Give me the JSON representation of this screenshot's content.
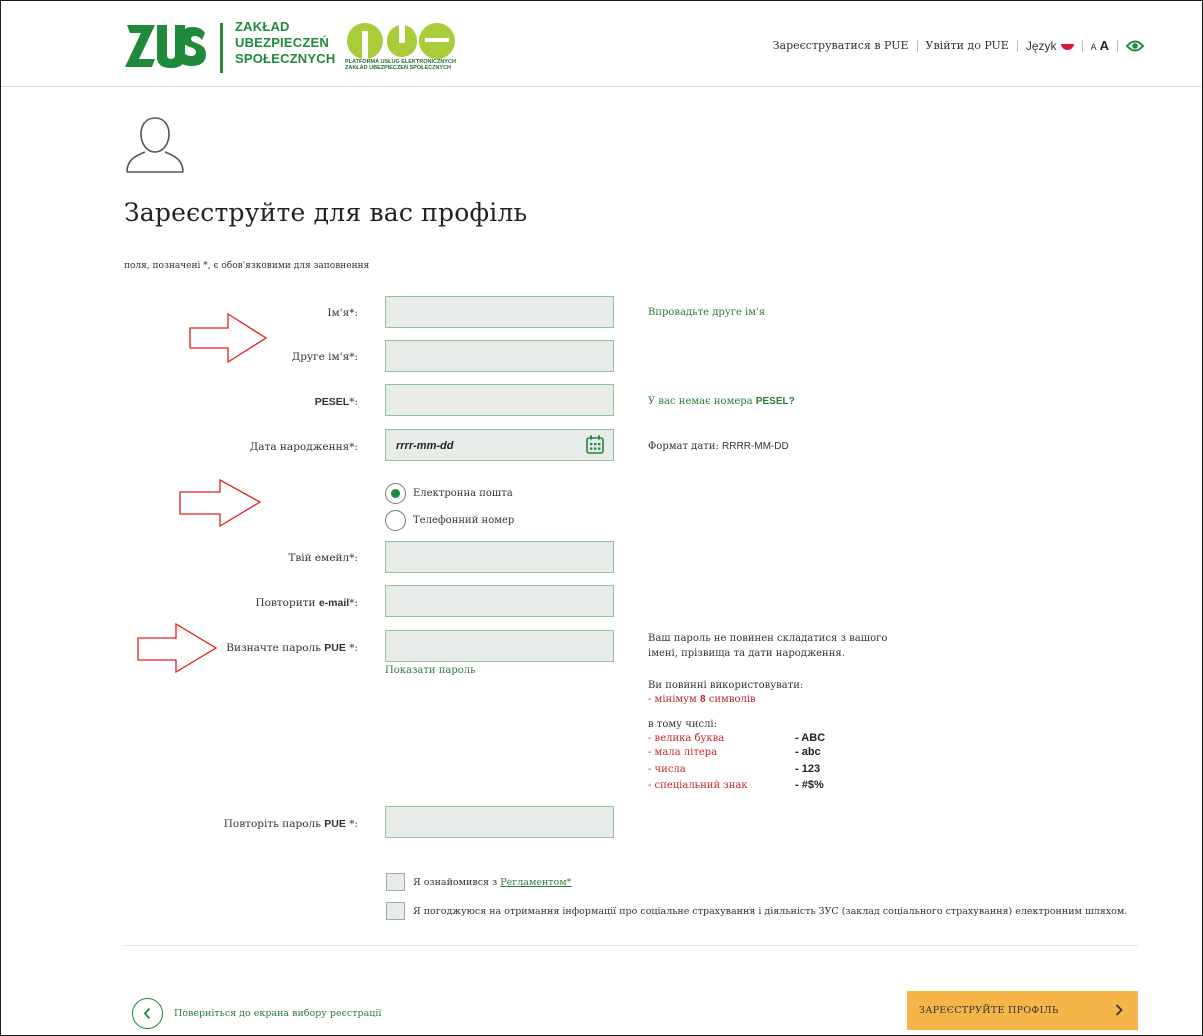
{
  "header": {
    "logo_text_lines": [
      "ZAKŁAD",
      "UBEZPIECZEŃ",
      "SPOŁECZNYCH"
    ],
    "pue_subtitle": "PLATFORMA USŁUG ELEKTRONICZNYCH ZAKŁAD UBEZPIECZEŃ SPOŁECZNYCH",
    "nav": {
      "register": "Зареєструватися в PUE",
      "login": "Увійти до PUE",
      "language": "Język",
      "font_small": "A",
      "font_large": "A"
    }
  },
  "page": {
    "title": "Зареєструйте для вас профіль",
    "required_note": "поля, позначені *, є обов'язковими для заповнення"
  },
  "form": {
    "first_name_label": "Ім'я*:",
    "first_name_value": "",
    "second_name_hint": "Впровадьте друге ім'я",
    "last_name_label": "Друге ім'я*:",
    "last_name_value": "",
    "pesel_label_prefix": "PESEL",
    "pesel_label_suffix": "*:",
    "pesel_value": "",
    "pesel_hint_prefix": "У вас немає номера ",
    "pesel_hint_bold": "PESEL?",
    "dob_label": "Дата народження*:",
    "dob_placeholder": "rrrr-mm-dd",
    "dob_format_prefix": "Формат дати: ",
    "dob_format": "RRRR-MM-DD",
    "contact_options": [
      {
        "label": "Електронна пошта",
        "selected": true
      },
      {
        "label": "Телефонний номер",
        "selected": false
      }
    ],
    "email_label": "Твій емейл*:",
    "email_value": "",
    "repeat_email_label_prefix": "Повторити ",
    "repeat_email_label_bold": "e-mail",
    "repeat_email_label_suffix": "*:",
    "repeat_email_value": "",
    "password_label_prefix": "Визначте пароль ",
    "password_label_bold": "PUE",
    "password_label_suffix": " *:",
    "password_value": "",
    "show_password": "Показати пароль",
    "repeat_password_label_prefix": "Повторіть пароль ",
    "repeat_password_label_bold": "PUE",
    "repeat_password_label_suffix": " *:",
    "repeat_password_value": ""
  },
  "password_rules": {
    "line1": "Ваш пароль не повинен складатися з вашого",
    "line2": "імені, прізвища та дати народження.",
    "must_use": "Ви повинні використовувати:",
    "min_prefix": "- мінімум ",
    "min_count": "8",
    "min_suffix": " символів",
    "including": "в тому числі:",
    "items": [
      {
        "text": "- велика буква",
        "example": "- ABC"
      },
      {
        "text": "- мала літера",
        "example": "- abc"
      },
      {
        "text": "- числа",
        "example": "- 123"
      },
      {
        "text": "- спеціальний знак",
        "example": "- #$%"
      }
    ]
  },
  "consents": {
    "terms_prefix": "Я ознайомився з ",
    "terms_link": "Регламентом*",
    "info": "Я погоджуюся на отримання інформації про соціальне страхування і діяльність ЗУС (заклад соціального страхування) електронним шляхом."
  },
  "footer": {
    "back_label": "Поверніться до екрана вибору реєстрації",
    "submit_label": "ЗАРЕЄСТРУЙТЕ ПРОФІЛЬ"
  },
  "colors": {
    "brand_green": "#1f8a3b",
    "input_bg": "#e8ece9",
    "input_border": "#8fc59b",
    "submit_bg": "#f6b548",
    "rule_red": "#c0272d",
    "annotation_arrow": "#e02020"
  },
  "icons": [
    "zus-logo",
    "pue-logo",
    "poland-flag-icon",
    "eye-icon",
    "user-avatar-icon",
    "calendar-icon",
    "chevron-left-icon",
    "chevron-right-icon",
    "annotation-arrow"
  ]
}
